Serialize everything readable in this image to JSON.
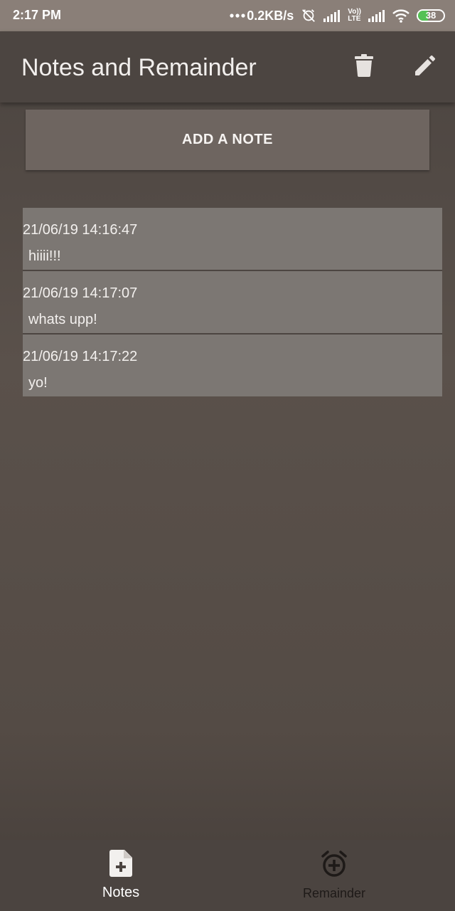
{
  "status_bar": {
    "time": "2:17 PM",
    "network_speed": "0.2KB/s",
    "volte_label_top": "Vo))",
    "volte_label_bottom": "LTE",
    "battery_level": "38",
    "battery_color": "#55c155",
    "icons": [
      "more-dots-icon",
      "alarm-off-icon",
      "signal-icon",
      "volte-icon",
      "signal-icon",
      "wifi-icon",
      "battery-icon"
    ]
  },
  "app_bar": {
    "title": "Notes and Remainder",
    "actions": [
      "trash-icon",
      "edit-icon"
    ]
  },
  "add_note_button": {
    "label": "ADD A NOTE"
  },
  "notes": [
    {
      "date": "21/06/19 14:16:47",
      "text": "hiiii!!!"
    },
    {
      "date": "21/06/19 14:17:07",
      "text": "whats upp!"
    },
    {
      "date": "21/06/19 14:17:22",
      "text": "yo!"
    }
  ],
  "bottom_nav": {
    "items": [
      {
        "label": "Notes",
        "icon": "note-add-icon",
        "active": true
      },
      {
        "label": "Remainder",
        "icon": "alarm-add-icon",
        "active": false
      }
    ]
  },
  "colors": {
    "status_bar": "#8a7f78",
    "app_bar": "#4c4541",
    "button": "#6e6560",
    "note_item": "#7c7773",
    "nav_bar": "#4b4440"
  }
}
